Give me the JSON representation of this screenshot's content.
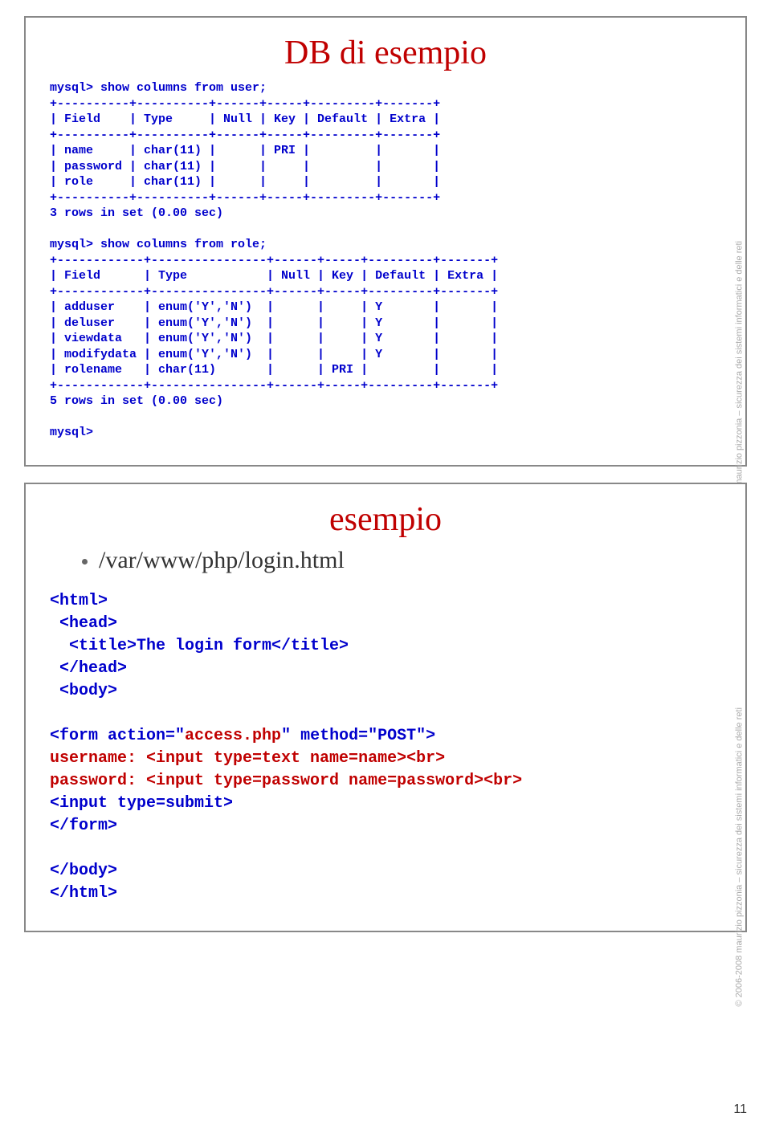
{
  "slide1": {
    "title": "DB di esempio",
    "sql": "mysql> show columns from user;\n+----------+----------+------+-----+---------+-------+\n| Field    | Type     | Null | Key | Default | Extra |\n+----------+----------+------+-----+---------+-------+\n| name     | char(11) |      | PRI |         |       |\n| password | char(11) |      |     |         |       |\n| role     | char(11) |      |     |         |       |\n+----------+----------+------+-----+---------+-------+\n3 rows in set (0.00 sec)\n\nmysql> show columns from role;\n+------------+----------------+------+-----+---------+-------+\n| Field      | Type           | Null | Key | Default | Extra |\n+------------+----------------+------+-----+---------+-------+\n| adduser    | enum('Y','N')  |      |     | Y       |       |\n| deluser    | enum('Y','N')  |      |     | Y       |       |\n| viewdata   | enum('Y','N')  |      |     | Y       |       |\n| modifydata | enum('Y','N')  |      |     | Y       |       |\n| rolename   | char(11)       |      | PRI |         |       |\n+------------+----------------+------+-----+---------+-------+\n5 rows in set (0.00 sec)\n\nmysql>"
  },
  "slide2": {
    "title": "esempio",
    "bullet": "/var/www/php/login.html",
    "code": {
      "l1": "<html>",
      "l2": " <head>",
      "l3": "  <title>The login form</title>",
      "l4": " </head>",
      "l5": " <body>",
      "l6": "",
      "l7a": "<form action=\"",
      "l7b": "access.php",
      "l7c": "\" method=\"POST\">",
      "l8": "username: <input type=text name=name><br>",
      "l9": "password: <input type=password name=password><br>",
      "l10": "<input type=submit>",
      "l11": "</form>",
      "l12": "",
      "l13": "</body>",
      "l14": "</html>"
    }
  },
  "copyright": "© 2006-2008 maurizio pizzonia – sicurezza dei sistemi informatici e delle reti",
  "pagenum": "11"
}
